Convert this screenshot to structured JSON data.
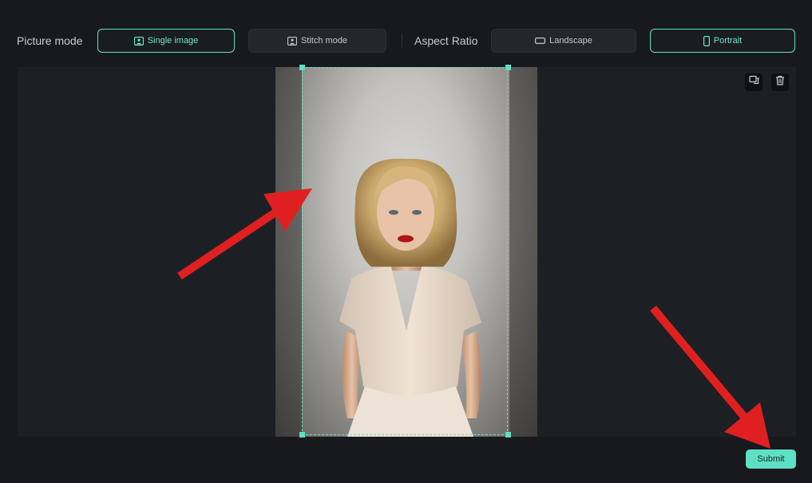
{
  "toolbar": {
    "picture_mode_label": "Picture mode",
    "single_image_label": "Single image",
    "stitch_mode_label": "Stitch mode",
    "aspect_ratio_label": "Aspect Ratio",
    "landscape_label": "Landscape",
    "portrait_label": "Portrait",
    "selected_picture_mode": "Single image",
    "selected_aspect_ratio": "Portrait"
  },
  "canvas": {
    "action_icons": [
      "replace-image-icon",
      "trash-icon"
    ]
  },
  "footer": {
    "submit_label": "Submit"
  },
  "colors": {
    "accent": "#5fe0c4",
    "background": "#17191c",
    "annotation_arrow": "#e02020"
  }
}
